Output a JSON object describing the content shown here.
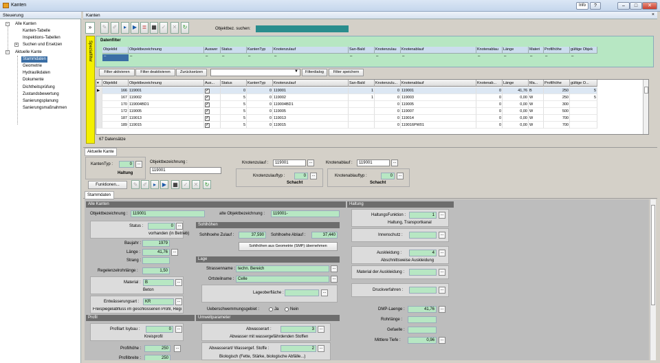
{
  "window": {
    "title": "Kanten",
    "info_label": "Info",
    "help_label": "?",
    "minimize": "–",
    "maximize": "□",
    "close": "✕"
  },
  "sidebar": {
    "header": "Steuerung",
    "items": [
      {
        "label": "Alle Kanten"
      },
      {
        "label": "Kanten-Tabelle"
      },
      {
        "label": "Inspektions-Tabellen"
      },
      {
        "label": "Suchen und Ersetzen"
      },
      {
        "label": "Aktuelle Kante"
      },
      {
        "label": "Stammdaten"
      },
      {
        "label": "Geometrie"
      },
      {
        "label": "Hydraulikdaten"
      },
      {
        "label": "Dokumente"
      },
      {
        "label": "Dichtheitsprüfung"
      },
      {
        "label": "Zustandsbewertung"
      },
      {
        "label": "Sanierungsplanung"
      },
      {
        "label": "Sanierungsmaßnahmen"
      }
    ]
  },
  "main": {
    "title": "Kanten",
    "close": "×"
  },
  "toolbar": {
    "search_label": "Objektbez. suchen:",
    "search_value": ""
  },
  "spezialfilter": {
    "label": "Spezialfilter"
  },
  "datenfilter": {
    "title": "Datenfilter",
    "columns": [
      "ObjektId",
      "Objektbezeichnung",
      "Auswer",
      "Status",
      "KantenTyp",
      "Knotenzulauf",
      "San-Bald",
      "Knotenzulau",
      "Knotenablauf",
      "Knotenablau",
      "Länge",
      "Materi",
      "Profilhöhe",
      "gültige Objek"
    ],
    "values": [
      "–",
      "–",
      "–",
      "–",
      "–",
      "–",
      "–",
      "–",
      "–",
      "–",
      "–",
      "–",
      "–",
      "–"
    ]
  },
  "filter_buttons": {
    "activate": "Filter aktivieren",
    "deactivate": "Filter deaktivieren",
    "reset": "Zurücksetzen",
    "dialog": "Filterdialog",
    "save": "Filter speichern"
  },
  "table": {
    "columns": [
      "ObjektId",
      "Objektbezeichnung",
      "Aus...",
      "Status",
      "KantenTyp",
      "Knotenzulauf",
      "San-Bald",
      "Knotenzulu...",
      "Knotenablauf",
      "Knotenab...",
      "Länge",
      "Ma...",
      "Profilhöhe",
      "gültige O..."
    ],
    "rows": [
      {
        "id": "166",
        "name": "119001",
        "status": "0",
        "typ": "0",
        "zulauf": "119001",
        "sanbald": "1",
        "zu2": "0",
        "ablauf": "119001",
        "ab2": "0",
        "laenge": "41,76",
        "mat": "B",
        "profil": "250",
        "gueltig": "5"
      },
      {
        "id": "167",
        "name": "119002",
        "status": "5",
        "typ": "0",
        "zulauf": "119002",
        "sanbald": "1",
        "zu2": "0",
        "ablauf": "119003",
        "ab2": "0",
        "laenge": "0,00",
        "mat": "W",
        "profil": "250",
        "gueltig": "5"
      },
      {
        "id": "170",
        "name": "119004BD1",
        "status": "5",
        "typ": "0",
        "zulauf": "119004BD1",
        "sanbald": "",
        "zu2": "0",
        "ablauf": "119005",
        "ab2": "0",
        "laenge": "0,00",
        "mat": "W",
        "profil": "300",
        "gueltig": ""
      },
      {
        "id": "172",
        "name": "119005",
        "status": "5",
        "typ": "0",
        "zulauf": "119005",
        "sanbald": "",
        "zu2": "0",
        "ablauf": "119007",
        "ab2": "0",
        "laenge": "0,00",
        "mat": "W",
        "profil": "500",
        "gueltig": ""
      },
      {
        "id": "187",
        "name": "119013",
        "status": "5",
        "typ": "0",
        "zulauf": "119013",
        "sanbald": "",
        "zu2": "0",
        "ablauf": "119014",
        "ab2": "0",
        "laenge": "0,00",
        "mat": "W",
        "profil": "700",
        "gueltig": ""
      },
      {
        "id": "189",
        "name": "119015",
        "status": "5",
        "typ": "0",
        "zulauf": "119015",
        "sanbald": "",
        "zu2": "0",
        "ablauf": "119016PW01",
        "ab2": "0",
        "laenge": "0,00",
        "mat": "W",
        "profil": "700",
        "gueltig": ""
      }
    ],
    "count": "67 Datensätze"
  },
  "current": {
    "tab": "Aktuelle Kante",
    "kantentyp_label": "KantenTyp :",
    "kantentyp_value": "0",
    "kantentyp_text": "Haltung",
    "objbez_label": "Objektbezeichnung :",
    "objbez_value": "119001",
    "knotenzulauf_label": "Knotenzulauf :",
    "knotenzulauf_value": "119001",
    "knotenzulauftyp_label": "Knotenzulauftyp :",
    "knotenzulauftyp_value": "0",
    "knotenzulauftyp_text": "Schacht",
    "knotenablauf_label": "Knotenablauf :",
    "knotenablauf_value": "119001",
    "knotenablauftyp_label": "Knotenablauftyp :",
    "knotenablauftyp_value": "0",
    "knotenablauftyp_text": "Schacht",
    "funktionen": "Funktionen..."
  },
  "stammdaten": {
    "tab": "Stammdaten",
    "alle_kanten": "Alle Kanten",
    "objbez_label": "Objektbezeichnung :",
    "objbez_value": "119001",
    "alte_label": "alte Objektbezeichnung :",
    "alte_value": "119001-",
    "status_label": "Status :",
    "status_value": "0",
    "status_text": "vorhanden (in Betrieb)",
    "baujahr_label": "Baujahr :",
    "baujahr_value": "1979",
    "laenge_label": "Länge :",
    "laenge_value": "41,76",
    "strang_label": "Strang :",
    "strang_value": "",
    "regel_label": "Regelenzelrohrlänge :",
    "regel_value": "1,50",
    "material_label": "Material :",
    "material_value": "B",
    "material_text": "Beton",
    "entw_label": "Entwässerungsart :",
    "entw_value": "KR",
    "entw_text": "Freispiegelabfluss im geschlossenen Profil, Regi",
    "sohlhoehen": "Sohlhöhen",
    "sz_label": "Sohlhoehe Zulauf :",
    "sz_value": "37,590",
    "sa_label": "Sohlhoehe Ablauf :",
    "sa_value": "37,440",
    "smp_button": "Sohlhöhen aus Geometrie (SMP) übernehmen",
    "lage": "Lage",
    "strasse_label": "Strassenname :",
    "strasse_value": "techn. Bereich",
    "ortsteil_label": "Ortsteilname :",
    "ortsteil_value": "Celle",
    "lageob_label": "Lageoberfläche :",
    "lageob_value": "",
    "ueber_label": "Ueberschwemmungsgebiet :",
    "ja": "Ja",
    "nein": "Nein",
    "profil": "Profil",
    "profilart_label": "Profilart Isybau :",
    "profilart_value": "0",
    "profilart_text": "Kreisprofil",
    "profilhoehe_label": "Profilhöhe :",
    "profilhoehe_value": "250",
    "profilbreite_label": "Profilbreite :",
    "profilbreite_value": "250",
    "umwelt": "Umweltparameter",
    "abw_label": "Abwasserart :",
    "abw_value": "3",
    "abw_text": "Abwasser mit wassergefährdenden Stoffen",
    "abw2_label": "Abwasserart/ Wassergef. Stoffe :",
    "abw2_value": "2",
    "abw2_text": "Biologisch (Fette, Stärke, biologische Abfälle...)",
    "haltung": "Haltung",
    "hf_label": "HaltungsFunktion :",
    "hf_value": "1",
    "hf_text": "Haltung, Transportkanal",
    "innen_label": "Innenschutz :",
    "innen_value": "",
    "ausk_label": "Auskleidung :",
    "ausk_value": "4",
    "ausk_text": "Abschnittsweise Auskleidung",
    "mausk_label": "Material der Auskleidung :",
    "mausk_value": "",
    "druck_label": "Druckverfahren :",
    "druck_value": "",
    "dmp_label": "DMP-Laenge :",
    "dmp_value": "41,76",
    "rohr_label": "Rohrlänge :",
    "rohr_value": "",
    "gef_label": "Gefaelle :",
    "gef_value": "",
    "tiefe_label": "Mittlere Tiefe :",
    "tiefe_value": "0,96"
  }
}
